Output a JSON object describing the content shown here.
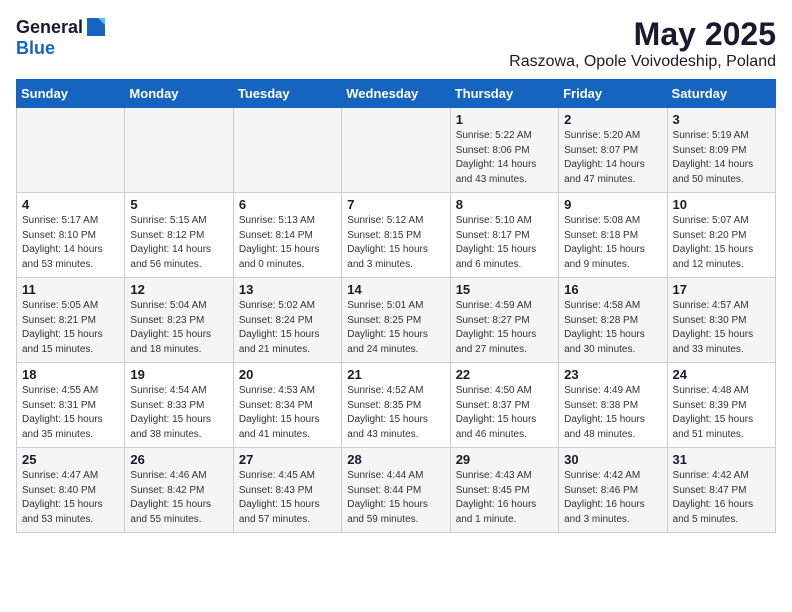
{
  "header": {
    "logo_general": "General",
    "logo_blue": "Blue",
    "title": "May 2025",
    "subtitle": "Raszowa, Opole Voivodeship, Poland"
  },
  "weekdays": [
    "Sunday",
    "Monday",
    "Tuesday",
    "Wednesday",
    "Thursday",
    "Friday",
    "Saturday"
  ],
  "weeks": [
    [
      {
        "day": "",
        "info": ""
      },
      {
        "day": "",
        "info": ""
      },
      {
        "day": "",
        "info": ""
      },
      {
        "day": "",
        "info": ""
      },
      {
        "day": "1",
        "info": "Sunrise: 5:22 AM\nSunset: 8:06 PM\nDaylight: 14 hours\nand 43 minutes."
      },
      {
        "day": "2",
        "info": "Sunrise: 5:20 AM\nSunset: 8:07 PM\nDaylight: 14 hours\nand 47 minutes."
      },
      {
        "day": "3",
        "info": "Sunrise: 5:19 AM\nSunset: 8:09 PM\nDaylight: 14 hours\nand 50 minutes."
      }
    ],
    [
      {
        "day": "4",
        "info": "Sunrise: 5:17 AM\nSunset: 8:10 PM\nDaylight: 14 hours\nand 53 minutes."
      },
      {
        "day": "5",
        "info": "Sunrise: 5:15 AM\nSunset: 8:12 PM\nDaylight: 14 hours\nand 56 minutes."
      },
      {
        "day": "6",
        "info": "Sunrise: 5:13 AM\nSunset: 8:14 PM\nDaylight: 15 hours\nand 0 minutes."
      },
      {
        "day": "7",
        "info": "Sunrise: 5:12 AM\nSunset: 8:15 PM\nDaylight: 15 hours\nand 3 minutes."
      },
      {
        "day": "8",
        "info": "Sunrise: 5:10 AM\nSunset: 8:17 PM\nDaylight: 15 hours\nand 6 minutes."
      },
      {
        "day": "9",
        "info": "Sunrise: 5:08 AM\nSunset: 8:18 PM\nDaylight: 15 hours\nand 9 minutes."
      },
      {
        "day": "10",
        "info": "Sunrise: 5:07 AM\nSunset: 8:20 PM\nDaylight: 15 hours\nand 12 minutes."
      }
    ],
    [
      {
        "day": "11",
        "info": "Sunrise: 5:05 AM\nSunset: 8:21 PM\nDaylight: 15 hours\nand 15 minutes."
      },
      {
        "day": "12",
        "info": "Sunrise: 5:04 AM\nSunset: 8:23 PM\nDaylight: 15 hours\nand 18 minutes."
      },
      {
        "day": "13",
        "info": "Sunrise: 5:02 AM\nSunset: 8:24 PM\nDaylight: 15 hours\nand 21 minutes."
      },
      {
        "day": "14",
        "info": "Sunrise: 5:01 AM\nSunset: 8:25 PM\nDaylight: 15 hours\nand 24 minutes."
      },
      {
        "day": "15",
        "info": "Sunrise: 4:59 AM\nSunset: 8:27 PM\nDaylight: 15 hours\nand 27 minutes."
      },
      {
        "day": "16",
        "info": "Sunrise: 4:58 AM\nSunset: 8:28 PM\nDaylight: 15 hours\nand 30 minutes."
      },
      {
        "day": "17",
        "info": "Sunrise: 4:57 AM\nSunset: 8:30 PM\nDaylight: 15 hours\nand 33 minutes."
      }
    ],
    [
      {
        "day": "18",
        "info": "Sunrise: 4:55 AM\nSunset: 8:31 PM\nDaylight: 15 hours\nand 35 minutes."
      },
      {
        "day": "19",
        "info": "Sunrise: 4:54 AM\nSunset: 8:33 PM\nDaylight: 15 hours\nand 38 minutes."
      },
      {
        "day": "20",
        "info": "Sunrise: 4:53 AM\nSunset: 8:34 PM\nDaylight: 15 hours\nand 41 minutes."
      },
      {
        "day": "21",
        "info": "Sunrise: 4:52 AM\nSunset: 8:35 PM\nDaylight: 15 hours\nand 43 minutes."
      },
      {
        "day": "22",
        "info": "Sunrise: 4:50 AM\nSunset: 8:37 PM\nDaylight: 15 hours\nand 46 minutes."
      },
      {
        "day": "23",
        "info": "Sunrise: 4:49 AM\nSunset: 8:38 PM\nDaylight: 15 hours\nand 48 minutes."
      },
      {
        "day": "24",
        "info": "Sunrise: 4:48 AM\nSunset: 8:39 PM\nDaylight: 15 hours\nand 51 minutes."
      }
    ],
    [
      {
        "day": "25",
        "info": "Sunrise: 4:47 AM\nSunset: 8:40 PM\nDaylight: 15 hours\nand 53 minutes."
      },
      {
        "day": "26",
        "info": "Sunrise: 4:46 AM\nSunset: 8:42 PM\nDaylight: 15 hours\nand 55 minutes."
      },
      {
        "day": "27",
        "info": "Sunrise: 4:45 AM\nSunset: 8:43 PM\nDaylight: 15 hours\nand 57 minutes."
      },
      {
        "day": "28",
        "info": "Sunrise: 4:44 AM\nSunset: 8:44 PM\nDaylight: 15 hours\nand 59 minutes."
      },
      {
        "day": "29",
        "info": "Sunrise: 4:43 AM\nSunset: 8:45 PM\nDaylight: 16 hours\nand 1 minute."
      },
      {
        "day": "30",
        "info": "Sunrise: 4:42 AM\nSunset: 8:46 PM\nDaylight: 16 hours\nand 3 minutes."
      },
      {
        "day": "31",
        "info": "Sunrise: 4:42 AM\nSunset: 8:47 PM\nDaylight: 16 hours\nand 5 minutes."
      }
    ]
  ]
}
